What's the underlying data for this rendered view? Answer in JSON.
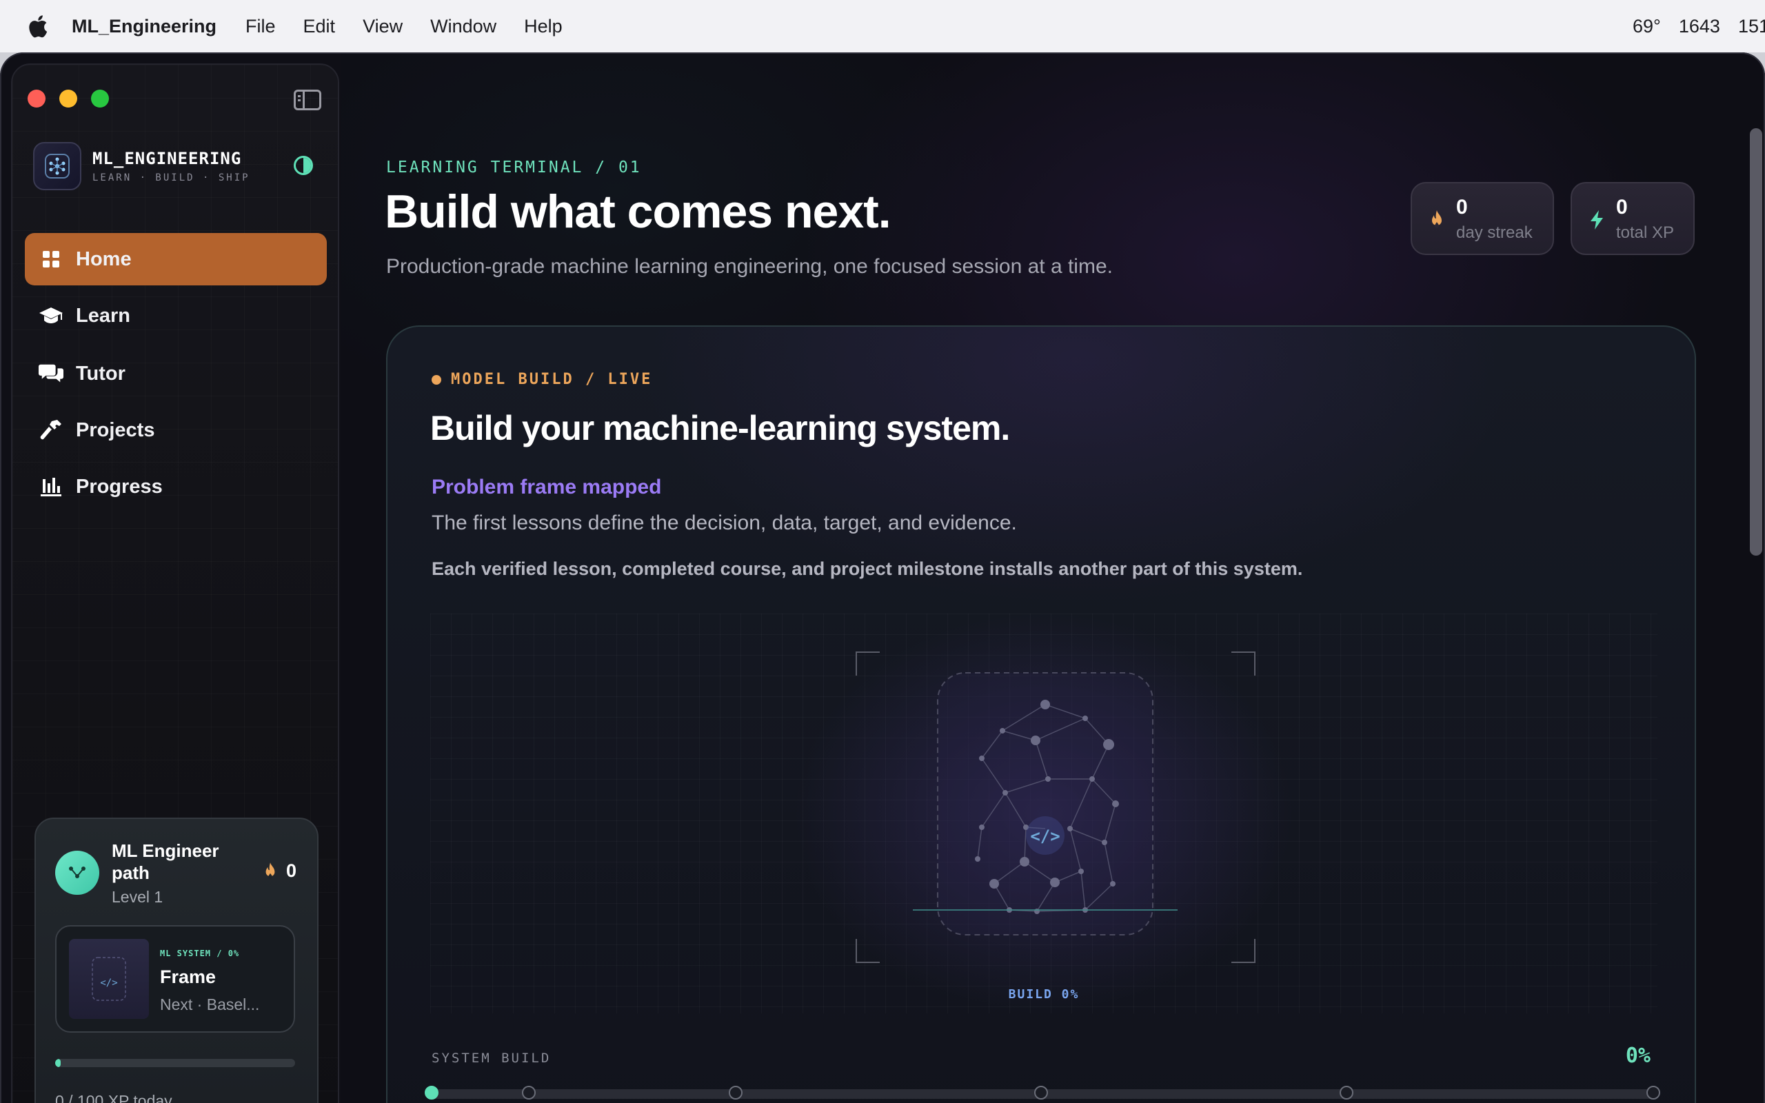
{
  "menubar": {
    "app_name": "ML_Engineering",
    "menus": [
      "File",
      "Edit",
      "View",
      "Window",
      "Help"
    ],
    "status": {
      "temperature": "69°",
      "time": "1643",
      "extra": "151"
    }
  },
  "sidebar": {
    "brand_name": "ML_ENGINEERING",
    "brand_tagline": "LEARN · BUILD · SHIP",
    "nav": [
      {
        "label": "Home",
        "icon": "grid-icon",
        "active": true
      },
      {
        "label": "Learn",
        "icon": "graduation-cap-icon"
      },
      {
        "label": "Tutor",
        "icon": "chat-bubbles-icon"
      },
      {
        "label": "Projects",
        "icon": "hammer-icon"
      },
      {
        "label": "Progress",
        "icon": "bar-chart-icon"
      }
    ],
    "path_card": {
      "title": "ML Engineer path",
      "level": "Level 1",
      "streak": "0",
      "mini": {
        "tag": "ML SYSTEM / 0%",
        "title": "Frame",
        "subtitle": "Next · Basel..."
      },
      "xp_progress": 0,
      "xp_label": "0 / 100 XP today"
    }
  },
  "main": {
    "eyebrow": "LEARNING TERMINAL / 01",
    "headline": "Build what comes next.",
    "subline": "Production-grade machine learning engineering, one focused session at a time.",
    "stats": [
      {
        "value": "0",
        "label": "day streak",
        "icon": "flame-icon"
      },
      {
        "value": "0",
        "label": "total XP",
        "icon": "bolt-icon"
      }
    ],
    "panel": {
      "live_tag": "MODEL BUILD / LIVE",
      "title": "Build your machine-learning system.",
      "accent": "Problem frame mapped",
      "description": "The first lessons define the decision, data, target, and evidence.",
      "description2": "Each verified lesson, completed course, and project milestone installs another part of this system.",
      "build_label": "BUILD 0%",
      "system_build_label": "SYSTEM BUILD",
      "system_build_pct": "0%",
      "milestones_done": 1
    }
  },
  "colors": {
    "accent_orange": "#b4632d",
    "mint": "#5ee0b6",
    "violet": "#9b7bf5",
    "amber": "#eda65b"
  }
}
